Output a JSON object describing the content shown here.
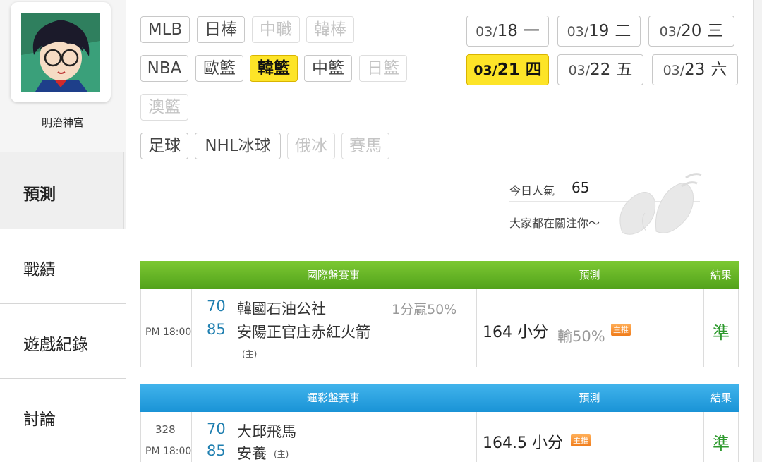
{
  "profile": {
    "username": "明治神宮"
  },
  "nav": [
    {
      "label": "預測",
      "active": true
    },
    {
      "label": "戰績",
      "active": false
    },
    {
      "label": "遊戲紀錄",
      "active": false
    },
    {
      "label": "討論",
      "active": false
    }
  ],
  "sports": {
    "row1": [
      "MLB",
      "日棒",
      "中職",
      "韓棒"
    ],
    "row2": [
      "NBA",
      "歐籃",
      "韓籃",
      "中籃",
      "日籃"
    ],
    "row3": [
      "澳籃"
    ],
    "row4": [
      "足球",
      "NHL冰球",
      "俄冰",
      "賽馬"
    ]
  },
  "dates": [
    {
      "month": "03/",
      "day": "18",
      "weekday": "一"
    },
    {
      "month": "03/",
      "day": "19",
      "weekday": "二"
    },
    {
      "month": "03/",
      "day": "20",
      "weekday": "三"
    },
    {
      "month": "03/",
      "day": "21",
      "weekday": "四"
    },
    {
      "month": "03/",
      "day": "22",
      "weekday": "五"
    },
    {
      "month": "03/",
      "day": "23",
      "weekday": "六"
    }
  ],
  "popularity": {
    "label": "今日人氣",
    "value": "65",
    "message": "大家都在關注你～"
  },
  "international": {
    "header": {
      "match": "國際盤賽事",
      "prediction": "預測",
      "result": "結果"
    },
    "game": {
      "time": "PM 18:00",
      "away_score": "70",
      "away_team": "韓國石油公社",
      "home_score": "85",
      "home_team": "安陽正官庄赤紅火箭",
      "host_mark": "(主)",
      "spread": "1分贏50%",
      "prediction": "164 小分",
      "prediction_sub": "輸50%",
      "badge": "主推",
      "result": "準"
    }
  },
  "lottery": {
    "header": {
      "match": "運彩盤賽事",
      "prediction": "預測",
      "result": "結果"
    },
    "game": {
      "game_no": "328",
      "time": "PM 18:00",
      "away_score": "70",
      "away_team": "大邱飛馬",
      "home_score": "85",
      "home_team": "安養",
      "host_mark": "(主)",
      "prediction": "164.5 小分",
      "badge": "主推",
      "result": "準"
    }
  },
  "colors": {
    "active_chip": "#fde428",
    "green_header": "#52a21b",
    "blue_header": "#1a93d6",
    "score": "#1f7fb0",
    "result": "#2e9a2e"
  }
}
